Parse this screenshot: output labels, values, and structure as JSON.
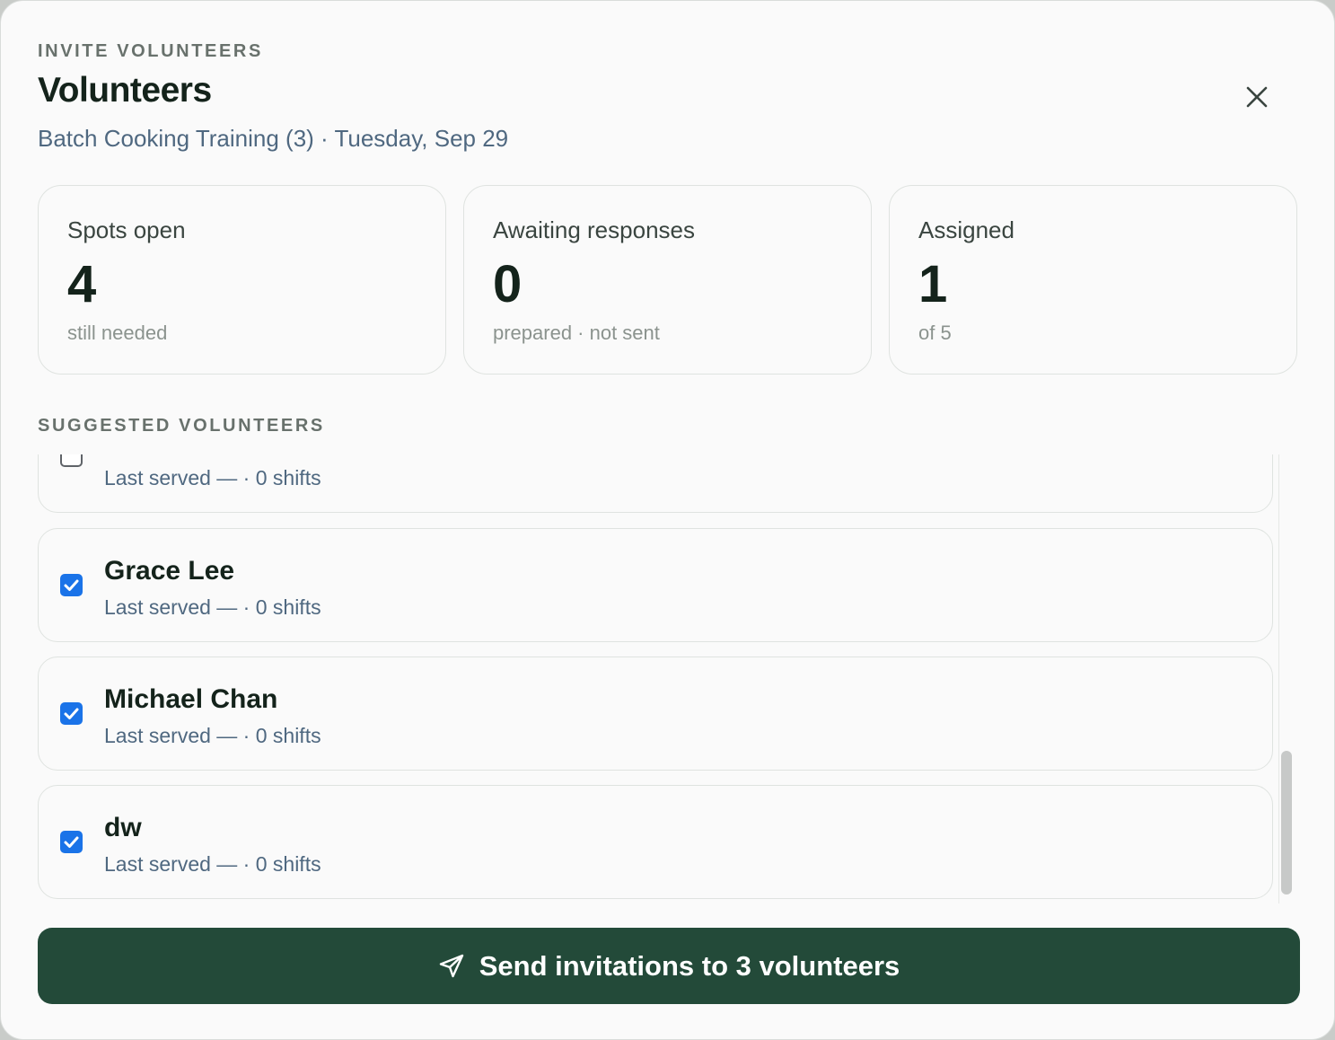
{
  "header": {
    "eyebrow": "INVITE VOLUNTEERS",
    "title": "Volunteers",
    "subtitle": "Batch Cooking Training (3) · Tuesday, Sep 29"
  },
  "stats": [
    {
      "label": "Spots open",
      "value": "4",
      "sub": "still needed"
    },
    {
      "label": "Awaiting responses",
      "value": "0",
      "sub": "prepared · not sent"
    },
    {
      "label": "Assigned",
      "value": "1",
      "sub": "of 5"
    }
  ],
  "suggested": {
    "label": "SUGGESTED VOLUNTEERS",
    "items": [
      {
        "name": "",
        "meta": "Last served — · 0 shifts",
        "checked": false
      },
      {
        "name": "Grace Lee",
        "meta": "Last served — · 0 shifts",
        "checked": true
      },
      {
        "name": "Michael Chan",
        "meta": "Last served — · 0 shifts",
        "checked": true
      },
      {
        "name": "dw",
        "meta": "Last served — · 0 shifts",
        "checked": true
      }
    ]
  },
  "actions": {
    "send_label": "Send invitations to 3 volunteers"
  },
  "colors": {
    "primary": "#234a39",
    "checkbox": "#1a73e8",
    "muted_blue": "#4f6880"
  },
  "icons": {
    "close": "close-icon",
    "send": "send-icon",
    "check": "check-icon"
  }
}
